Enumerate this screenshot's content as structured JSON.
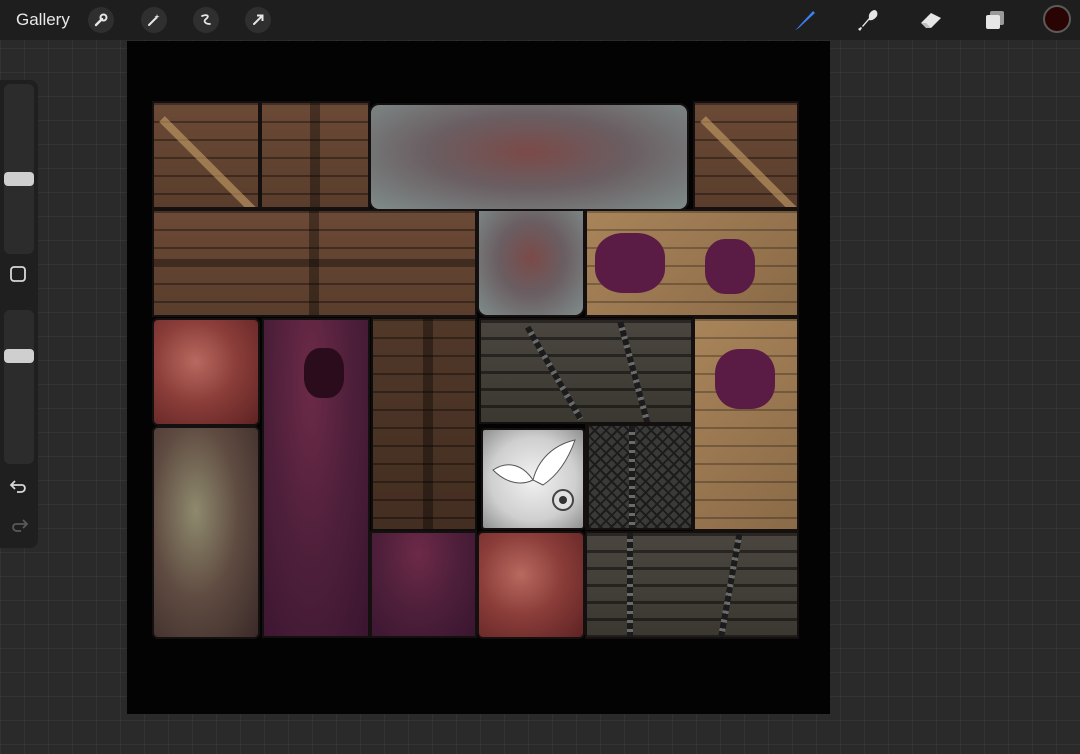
{
  "topbar": {
    "gallery_label": "Gallery",
    "left_tools": [
      "wrench-icon",
      "magic-wand-icon",
      "selection-icon",
      "transform-arrow-icon"
    ],
    "right_tools": [
      "brush-icon",
      "smudge-icon",
      "eraser-icon",
      "layers-icon"
    ],
    "active_tool": "brush-icon",
    "current_color": "#2a0303",
    "accent_color": "#3b7ff5"
  },
  "sidebar": {
    "brush_size_level": 0.35,
    "opacity_level": 0.28,
    "icons": [
      "modify-square-icon",
      "undo-icon",
      "redo-icon"
    ]
  }
}
